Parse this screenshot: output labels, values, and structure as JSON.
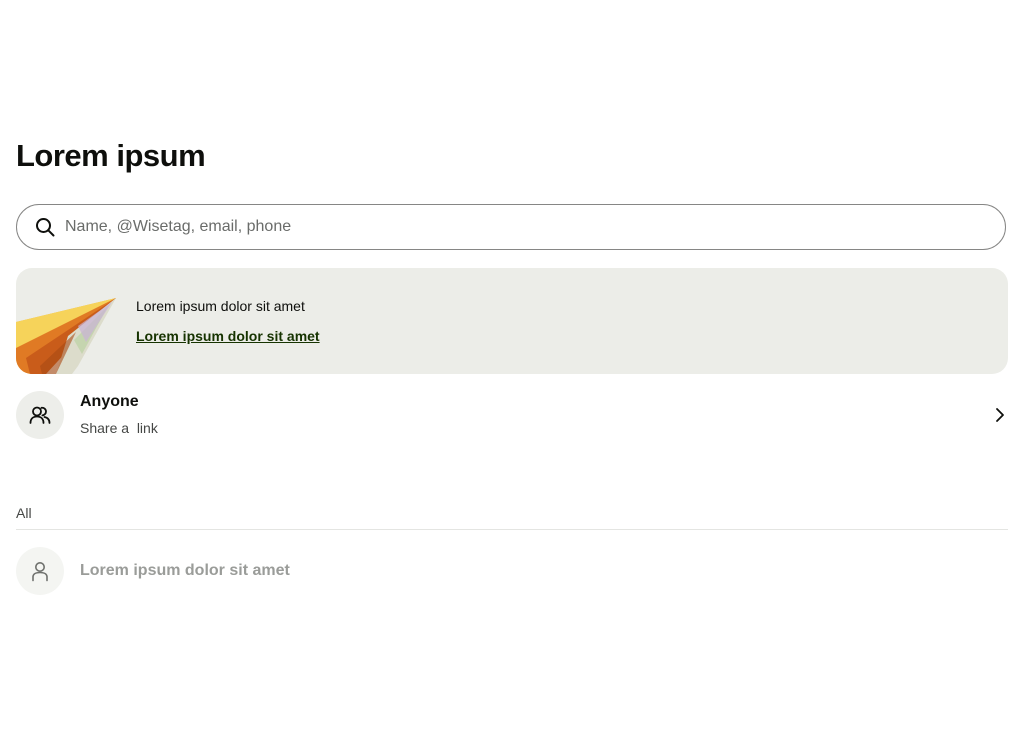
{
  "page": {
    "title": "Lorem ipsum"
  },
  "search": {
    "placeholder": "Name, @Wisetag, email, phone",
    "value": "",
    "icon": "search-icon"
  },
  "promo": {
    "text": "Lorem ipsum dolor sit amet",
    "link_label": "Lorem ipsum dolor sit amet",
    "illustration": "paper-plane-illustration",
    "background": "#ecede8",
    "link_color": "#163300"
  },
  "anyone": {
    "name": "Anyone",
    "subtitle": "Share a  link",
    "icon": "group-icon",
    "chevron": "chevron-right-icon"
  },
  "list": {
    "section_label": "All",
    "items": [
      {
        "name": "Lorem ipsum dolor sit amet",
        "icon": "person-icon",
        "disabled": true
      }
    ]
  }
}
